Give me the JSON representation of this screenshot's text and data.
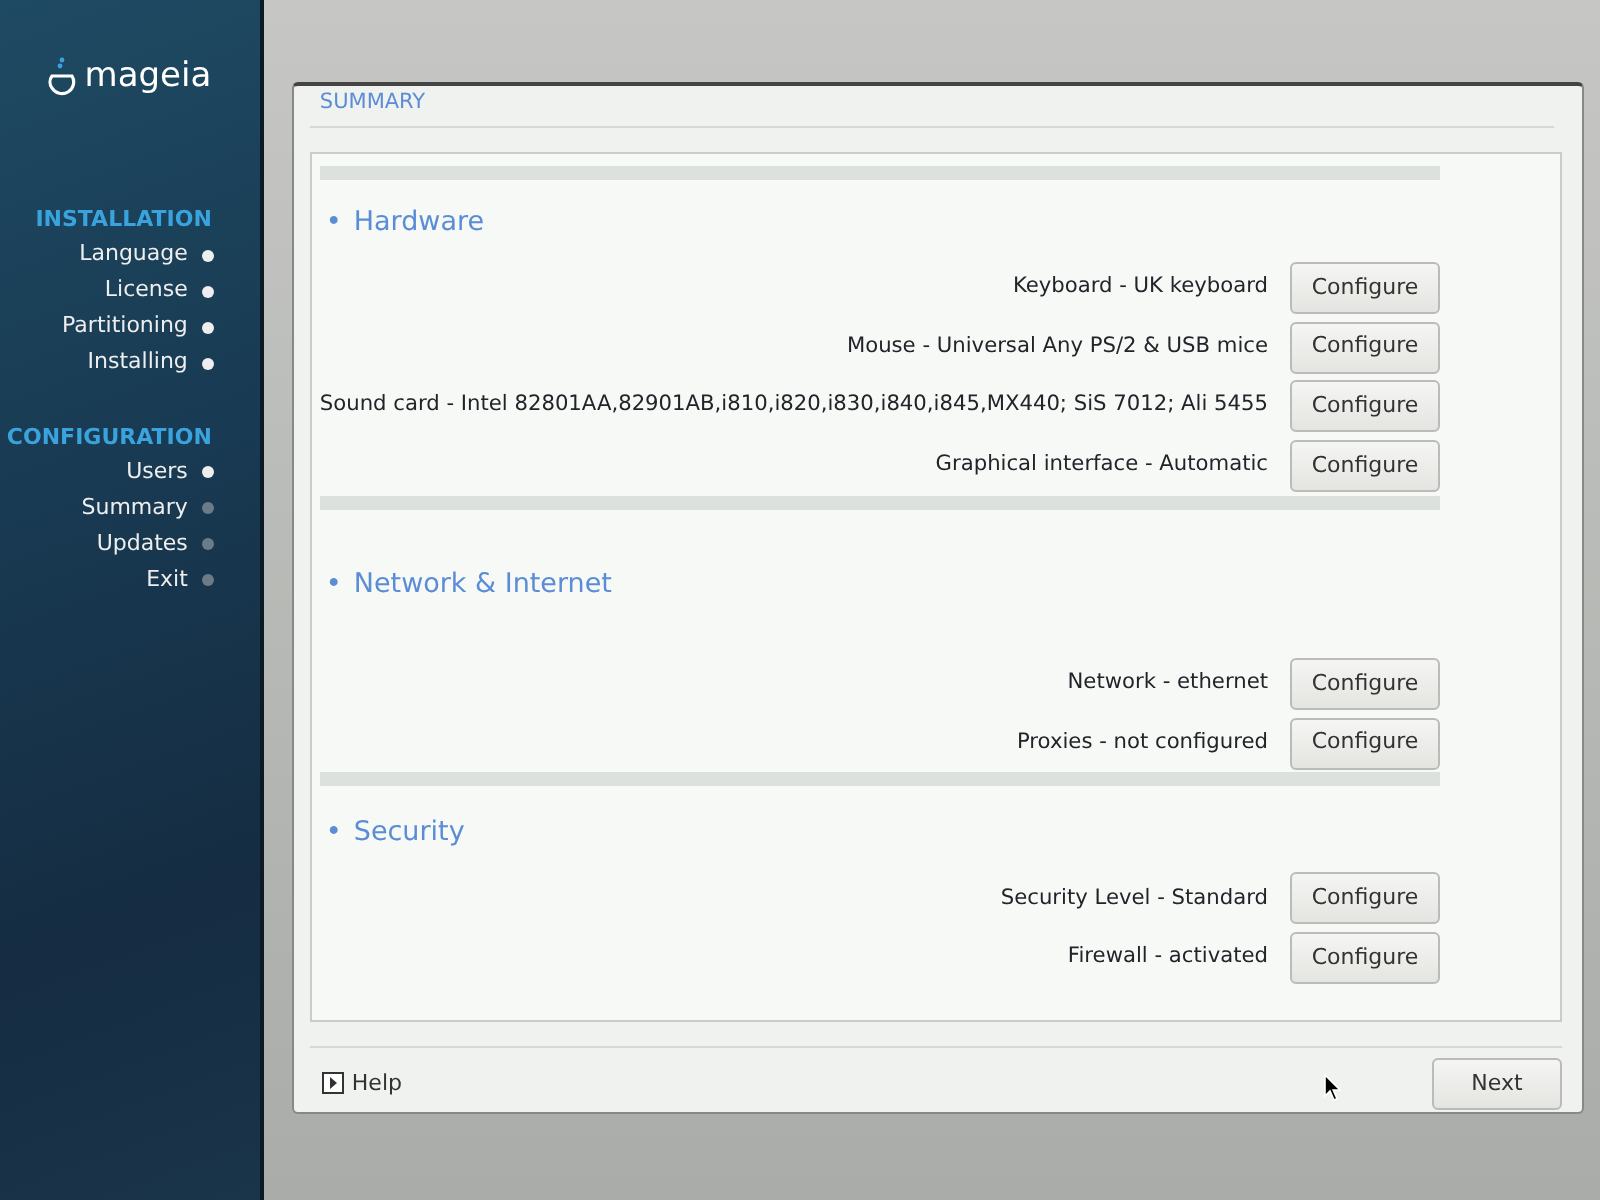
{
  "sidebar": {
    "logo": "mageia",
    "groups": [
      {
        "title": "INSTALLATION",
        "steps": [
          {
            "label": "Language",
            "done": true
          },
          {
            "label": "License",
            "done": true
          },
          {
            "label": "Partitioning",
            "done": true
          },
          {
            "label": "Installing",
            "done": true
          }
        ]
      },
      {
        "title": "CONFIGURATION",
        "steps": [
          {
            "label": "Users",
            "done": true
          },
          {
            "label": "Summary",
            "done": false
          },
          {
            "label": "Updates",
            "done": false
          },
          {
            "label": "Exit",
            "done": false
          }
        ]
      }
    ]
  },
  "dialog": {
    "title": "SUMMARY",
    "sections": [
      {
        "bullet": "•",
        "title": "Hardware",
        "items": [
          {
            "label": "Keyboard - UK keyboard",
            "button": "Configure"
          },
          {
            "label": "Mouse - Universal Any PS/2 & USB mice",
            "button": "Configure"
          },
          {
            "label": "Sound card - Intel 82801AA,82901AB,i810,i820,i830,i840,i845,MX440; SiS 7012; Ali 5455",
            "button": "Configure"
          },
          {
            "label": "Graphical interface - Automatic",
            "button": "Configure"
          }
        ]
      },
      {
        "bullet": "•",
        "title": "Network & Internet",
        "items": [
          {
            "label": "Network - ethernet",
            "button": "Configure"
          },
          {
            "label": "Proxies - not configured",
            "button": "Configure"
          }
        ]
      },
      {
        "bullet": "•",
        "title": "Security",
        "items": [
          {
            "label": "Security Level - Standard",
            "button": "Configure"
          },
          {
            "label": "Firewall - activated",
            "button": "Configure"
          }
        ]
      }
    ],
    "help": "Help",
    "next": "Next"
  }
}
